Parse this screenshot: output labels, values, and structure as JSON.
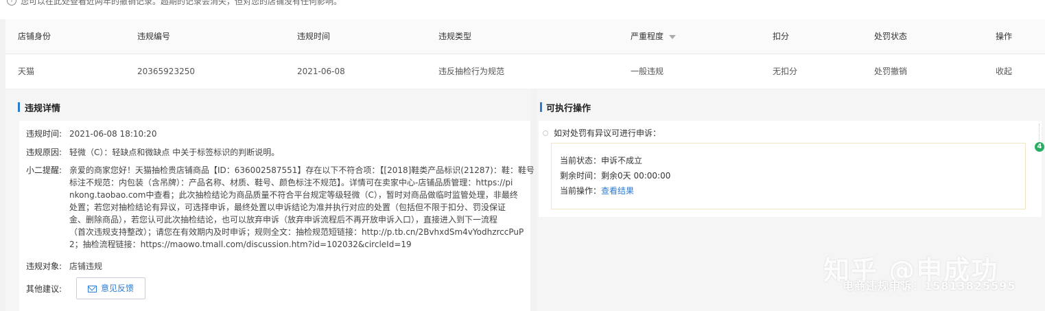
{
  "notice": {
    "icon": "info-icon",
    "text": "您可以在此处查看近两年的撤销记录。超期的记录会消失，但对您的店铺没有任何影响。"
  },
  "table": {
    "headers": [
      "店铺身份",
      "违规编号",
      "违规时间",
      "违规类型",
      "严重程度",
      "扣分",
      "处罚状态",
      "操作"
    ],
    "filter_icon": "filter-icon",
    "row": [
      "天猫",
      "20365923250",
      "2021-06-08",
      "违反抽检行为规范",
      "一般违规",
      "无扣分",
      "处罚撤销",
      "收起"
    ]
  },
  "detail": {
    "title": "违规详情",
    "time_label": "违规时间:",
    "time_value": "2021-06-08 18:10:20",
    "reason_label": "违规原因:",
    "reason_value": "轻微（C）：轻缺点和微缺点 中关于标签标识的判断说明。",
    "note_label": "小二提醒:",
    "note_lines": [
      "亲爱的商家您好！天猫抽检贵店铺商品【ID：636002587551】存在以下不符合项：【[2018]鞋类产品标识(21287)：鞋：鞋号",
      "标注不规范：内包装（含吊牌）：产品名称、材质、鞋号、颜色标注不规范】。详情可在卖家中心-店铺品质管理：https://pi",
      "nkong.taobao.com中查看；此次抽检结论为商品质量不符合平台规定等级轻微（C），暂时对商品做临时监管处理，非最终",
      "处置；若您对抽检结论有异议，可选择申诉，最终处置以申诉结论为准并执行对应的处置（包括但不限于扣分、罚没保证",
      "金、删除商品），若您认可此次抽检结论，也可以放弃申诉（放弃申诉流程后不再开放申诉入口），直接进入到下一流程",
      "（首次违规支持整改）；请您在有效期内及时申诉；规则全文：抽检规范短链接：http://p.tb.cn/2BvhxdSm4vYodhzrccPuP",
      "2；抽检流程链接：https://maowo.tmall.com/discussion.htm?id=102032&circleId=19"
    ],
    "target_label": "违规对象:",
    "target_value": "店铺违规",
    "suggest_label": "其他建议:",
    "feedback_label": "意见反馈",
    "feedback_icon": "mail-icon"
  },
  "actions": {
    "title": "可执行操作",
    "appeal_prompt": "如对处罚有异议可进行申诉：",
    "status_label": "当前状态：",
    "status_value": "申诉不成立",
    "remaining_label": "剩余时间：",
    "remaining_value": "剩余0天 00:00:00",
    "op_label": "当前操作：",
    "op_link": "查看结果",
    "step_badge": "4"
  },
  "watermark": {
    "line1": "知乎 @申成功",
    "line2": "电商违规申诉：15813825595"
  }
}
